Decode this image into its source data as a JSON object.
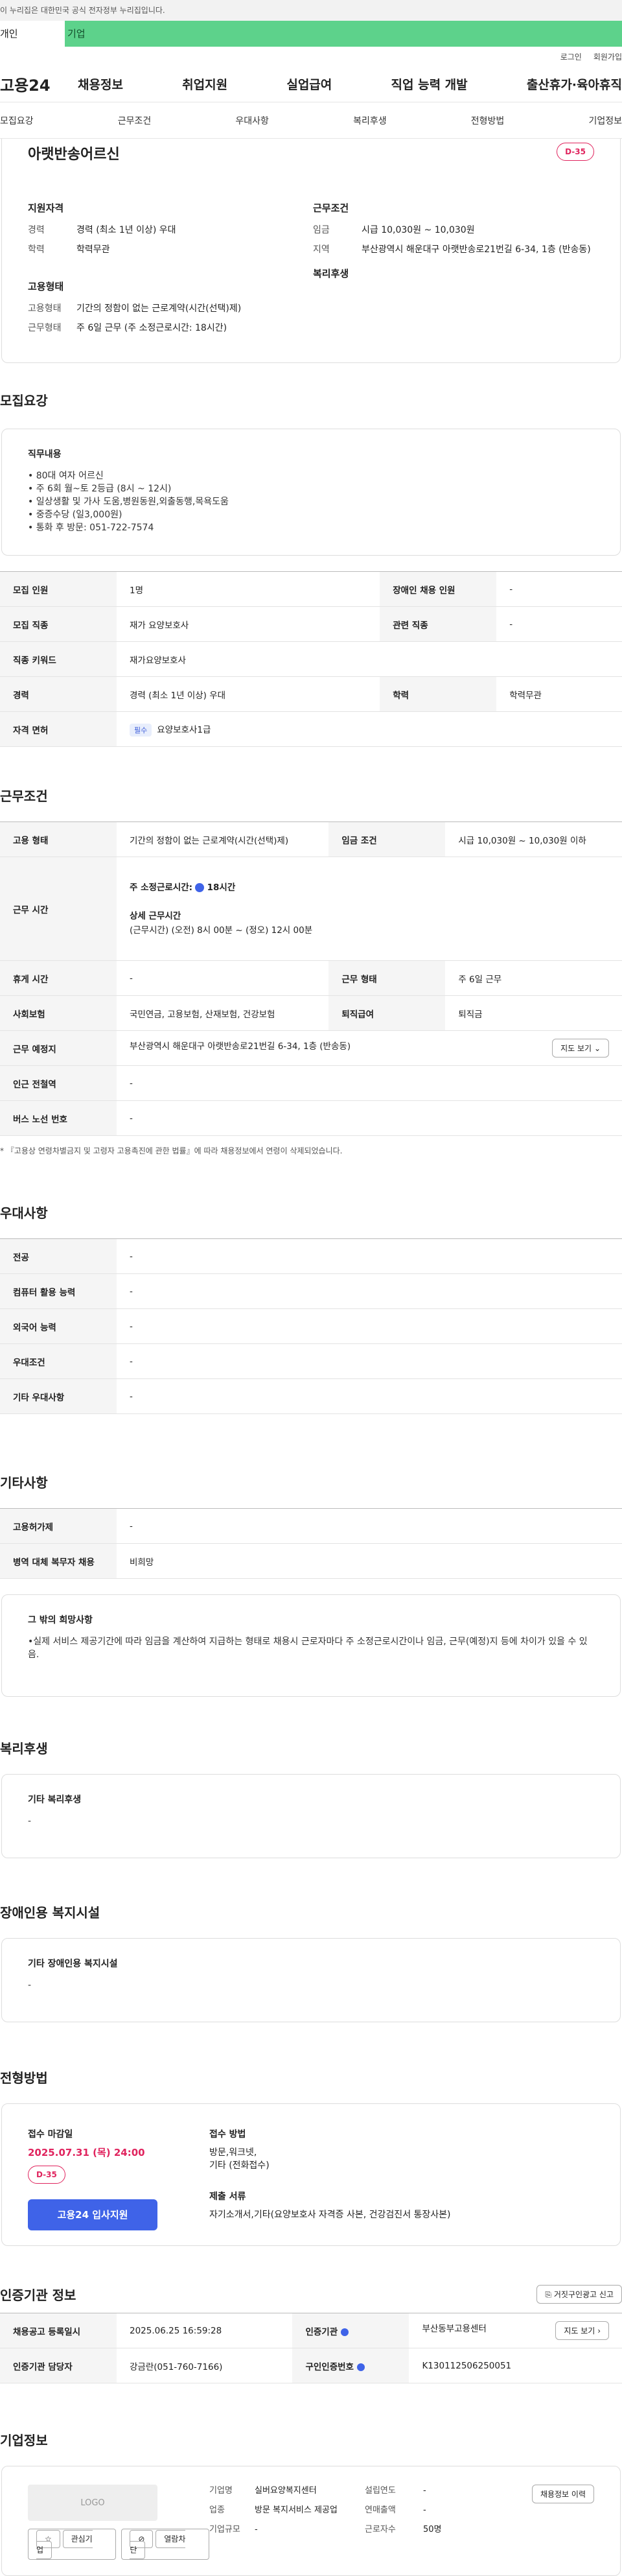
{
  "gov_notice": "이 누리집은 대한민국 공식 전자정부 누리집입니다.",
  "service_tabs": [
    "개인",
    "기업"
  ],
  "util_links": [
    "로그인",
    "회원가입"
  ],
  "brand": "고용24",
  "gnb": [
    "채용정보",
    "취업지원",
    "실업급여",
    "직업 능력 개발",
    "출산휴가·육아휴직"
  ],
  "page_tabs": [
    "모집요강",
    "근무조건",
    "우대사항",
    "복리후생",
    "전형방법",
    "기업정보"
  ],
  "summary": {
    "title": "아랫반송어르신",
    "dday": "D-35",
    "qual_title": "지원자격",
    "qual": [
      {
        "k": "경력",
        "v": "경력 (최소 1년 이상) 우대"
      },
      {
        "k": "학력",
        "v": "학력무관"
      }
    ],
    "work_title": "근무조건",
    "work": [
      {
        "k": "임금",
        "v": "시급 10,030원 ~ 10,030원"
      },
      {
        "k": "지역",
        "v": "부산광역시 해운대구 아랫반송로21번길 6-34, 1층 (반송동)"
      }
    ],
    "emp_title": "고용형태",
    "emp": [
      {
        "k": "고용형태",
        "v": "기간의 정함이 없는 근로계약(시간(선택)제)"
      },
      {
        "k": "근무형태",
        "v": "주 6일 근무 (주 소정근로시간: 18시간)"
      }
    ],
    "welfare_title": "복리후생"
  },
  "recruit": {
    "title": "모집요강",
    "job_title": "직무내용",
    "job_lines": [
      "• 80대 여자 어르신",
      "• 주 6회 월~토 2등급 (8시 ~ 12시)",
      "• 일상생활 및 가사 도움,병원동원,외출동행,목욕도움",
      "• 중증수당 (일3,000원)",
      "• 통화 후 방문: 051-722-7574"
    ],
    "rows": [
      {
        "k1": "모집 인원",
        "v1": "1명",
        "k2": "장애인 채용 인원",
        "v2": "-"
      },
      {
        "k1": "모집 직종",
        "v1": "재가 요양보호사",
        "k2": "관련 직종",
        "v2": "-"
      },
      {
        "k1": "직종 키워드",
        "v1": "재가요양보호사"
      },
      {
        "k1": "경력",
        "v1": "경력 (최소 1년 이상) 우대",
        "k2": "학력",
        "v2": "학력무관"
      },
      {
        "k1": "자격 면허",
        "tag": "필수",
        "v1": "요양보호사1급"
      }
    ]
  },
  "conditions": {
    "title": "근무조건",
    "emp_type_k": "고용 형태",
    "emp_type_v": "기간의 정함이 없는 근로계약(시간(선택)제)",
    "wage_k": "임금 조건",
    "wage_v": "시급 10,030원 ~ 10,030원 이하",
    "hours_k": "근무 시간",
    "hours_week": "주 소정근로시간:",
    "hours_week_v": "18시간",
    "hours_detail_t": "상세 근무시간",
    "hours_detail_v": "(근무시간) (오전) 8시 00분 ~ (정오) 12시 00분",
    "rest_k": "휴게 시간",
    "rest_v": "-",
    "form_k": "근무 형태",
    "form_v": "주 6일 근무",
    "ins_k": "사회보험",
    "ins_v": "국민연금, 고용보험, 산재보험, 건강보험",
    "sev_k": "퇴직급여",
    "sev_v": "퇴직금",
    "place_k": "근무 예정지",
    "place_v": "부산광역시 해운대구 아랫반송로21번길 6-34, 1층 (반송동)",
    "map_btn": "지도 보기",
    "subway_k": "인근 전철역",
    "subway_v": "-",
    "bus_k": "버스 노선 번호",
    "bus_v": "-",
    "note": "* 『고용상 연령차별금지 및 고령자 고용촉진에 관한 법률』에 따라 채용정보에서 연령이 삭제되었습니다."
  },
  "pref": {
    "title": "우대사항",
    "rows": [
      {
        "k": "전공",
        "v": "-"
      },
      {
        "k": "컴퓨터 활용 능력",
        "v": "-"
      },
      {
        "k": "외국어 능력",
        "v": "-"
      },
      {
        "k": "우대조건",
        "v": "-"
      },
      {
        "k": "기타 우대사항",
        "v": "-"
      }
    ]
  },
  "etc": {
    "title": "기타사항",
    "rows": [
      {
        "k": "고용허가제",
        "v": "-"
      },
      {
        "k": "병역 대체 복무자 채용",
        "v": "비희망"
      }
    ],
    "other_title": "그 밖의 희망사항",
    "other_text": "•실제 서비스 제공기간에 따라 임금을 계산하여  지급하는 형태로 채용시 근로자마다 주 소정근로시간이나 임금, 근무(예정)지 등에 차이가 있을 수 있음."
  },
  "welfare": {
    "title": "복리후생",
    "sub": "기타 복리후생",
    "v": "-"
  },
  "disabled": {
    "title": "장애인용 복지시설",
    "sub": "기타 장애인용 복지시설",
    "v": "-"
  },
  "apply": {
    "title": "전형방법",
    "deadline_t": "접수 마감일",
    "deadline_v": "2025.07.31 (목) 24:00",
    "dday": "D-35",
    "btn": "고용24 입사지원",
    "method_t": "접수 방법",
    "method_lines": [
      "방문,워크넷,",
      "기타 (전화접수)"
    ],
    "docs_t": "제출 서류",
    "docs_v": "자기소개서,기타(요양보호사 자격증 사본, 건강검진서 통장사본)"
  },
  "auth": {
    "title": "인증기관 정보",
    "report_btn": "거짓구인광고 신고",
    "r1k1": "채용공고 등록일시",
    "r1v1": "2025.06.25 16:59:28",
    "r1k2": "인증기관",
    "r1v2": "부산동부고용센터",
    "r1btn": "지도 보기",
    "r2k1": "인증기관 담당자",
    "r2v1": "강금란(051-760-7166)",
    "r2k2": "구인인증번호",
    "r2v2": "K130112506250051"
  },
  "company": {
    "title": "기업정보",
    "logo": "LOGO",
    "btn_fav": "관심기업",
    "btn_block": "열람차단",
    "info_btn": "채용정보 이력",
    "f": [
      {
        "k": "기업명",
        "v": "실버요양복지센터"
      },
      {
        "k": "업종",
        "v": "방문 복지서비스 제공업"
      },
      {
        "k": "기업규모",
        "v": "-"
      }
    ],
    "f2": [
      {
        "k": "설립연도",
        "v": "-"
      },
      {
        "k": "연매출액",
        "v": "-"
      },
      {
        "k": "근로자수",
        "v": "50명"
      }
    ]
  }
}
